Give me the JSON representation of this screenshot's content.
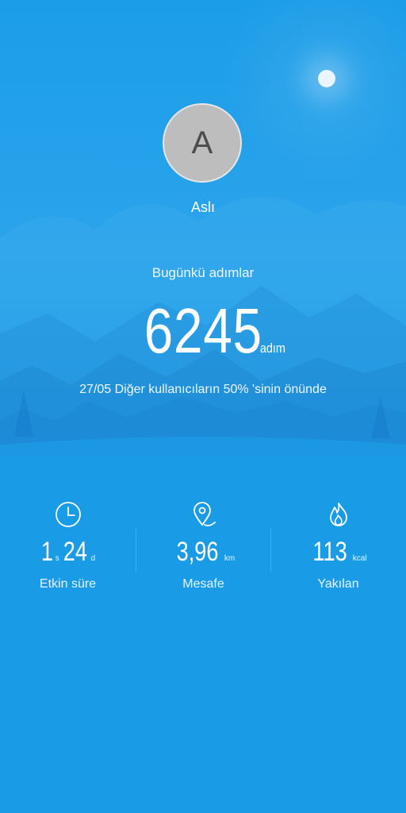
{
  "user": {
    "avatar_initial": "A",
    "name": "Aslı"
  },
  "steps": {
    "label": "Bugünkü adımlar",
    "value": "6245",
    "unit": "adım",
    "ranking_text": "27/05 Diğer kullanıcıların 50% 'sinin önünde"
  },
  "stats": {
    "active_time": {
      "hours": "1",
      "hours_unit": "s",
      "minutes": "24",
      "minutes_unit": "d",
      "label": "Etkin süre",
      "icon": "clock-icon"
    },
    "distance": {
      "value": "3,96",
      "unit": "km",
      "label": "Mesafe",
      "icon": "location-pin-icon"
    },
    "calories": {
      "value": "113",
      "unit": "kcal",
      "label": "Yakılan",
      "icon": "flame-icon"
    }
  },
  "colors": {
    "background": "#1a9be6",
    "text": "#ffffff"
  }
}
